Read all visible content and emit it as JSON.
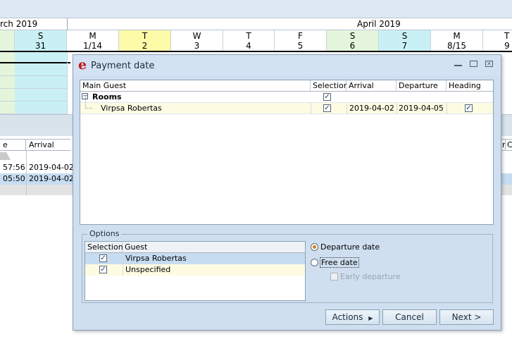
{
  "calendar": {
    "month_prev": "rch 2019",
    "month_current": "April 2019",
    "days": [
      {
        "dow": "S",
        "num": "31"
      },
      {
        "dow": "M",
        "num": "1/14"
      },
      {
        "dow": "T",
        "num": "2"
      },
      {
        "dow": "W",
        "num": "3"
      },
      {
        "dow": "T",
        "num": "4"
      },
      {
        "dow": "F",
        "num": "5"
      },
      {
        "dow": "S",
        "num": "6"
      },
      {
        "dow": "S",
        "num": "7"
      },
      {
        "dow": "M",
        "num": "8/15"
      },
      {
        "dow": "T",
        "num": "9"
      }
    ],
    "colors": {
      "weekend_green": "#e4f5dc",
      "weekend_cyan": "#c9f1f5",
      "today_yellow": "#fdfaa8"
    }
  },
  "bg_list": {
    "headers": [
      "e",
      "Arrival"
    ],
    "right_headers": [
      "r",
      "C"
    ],
    "rows": [
      {
        "time": "57:56",
        "arrival": "2019-04-02"
      },
      {
        "time": "05:50",
        "arrival": "2019-04-02"
      }
    ]
  },
  "dialog": {
    "title": "Payment date",
    "logo": "e",
    "grid": {
      "headers": {
        "main_guest": "Main Guest",
        "selection": "Selection",
        "arrival": "Arrival",
        "departure": "Departure",
        "heading": "Heading"
      },
      "group": {
        "toggle": "−",
        "label": "Rooms",
        "selected": true
      },
      "rows": [
        {
          "guest": "Virpsa Robertas",
          "selected": true,
          "arrival": "2019-04-02",
          "departure": "2019-04-05",
          "heading": true
        }
      ]
    },
    "options": {
      "legend": "Options",
      "headers": {
        "selection": "Selection",
        "guest": "Guest"
      },
      "rows": [
        {
          "guest": "Virpsa Robertas",
          "selected": true
        },
        {
          "guest": "Unspecified",
          "selected": true
        }
      ],
      "radio_departure": "Departure date",
      "radio_free": "Free date",
      "early_departure": "Early departure"
    },
    "buttons": {
      "actions": "Actions",
      "cancel": "Cancel",
      "next": "Next >"
    },
    "checkmark": "✓"
  }
}
